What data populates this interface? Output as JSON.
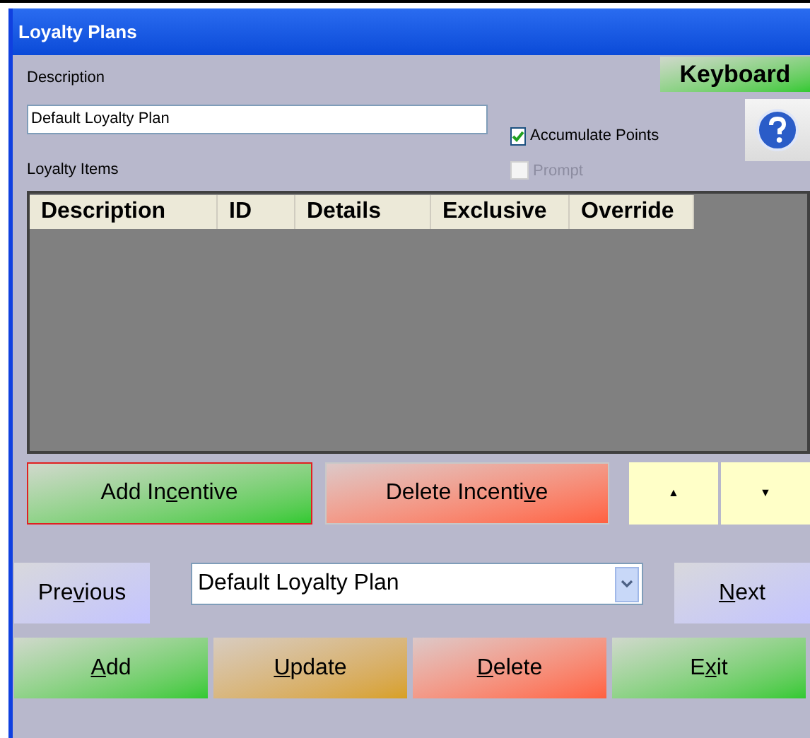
{
  "window": {
    "title": "Loyalty Plans"
  },
  "description": {
    "label": "Description",
    "value": "Default Loyalty Plan"
  },
  "keyboard_button": {
    "label": "Keyboard"
  },
  "options": [
    {
      "label": "Accumulate Points",
      "checked": true,
      "disabled": false
    },
    {
      "label": "Prompt",
      "checked": false,
      "disabled": true
    }
  ],
  "loyalty_items": {
    "label": "Loyalty Items",
    "columns": [
      "Description",
      "ID",
      "Details",
      "Exclusive",
      "Override"
    ]
  },
  "item_buttons": [
    {
      "label": {
        "before": "Add In",
        "key": "c",
        "after": "entive"
      },
      "kind": "green",
      "focused": true
    },
    {
      "label": {
        "before": "Delete Incenti",
        "key": "v",
        "after": "e"
      },
      "kind": "red",
      "focused": false
    }
  ],
  "move_buttons": [
    {
      "label": "▲"
    },
    {
      "label": "▼"
    }
  ],
  "navigation": {
    "previous": {
      "before": "Pre",
      "key": "v",
      "after": "ious"
    },
    "plan": "Default Loyalty Plan",
    "next": {
      "key": "N",
      "after": "ext"
    }
  },
  "bottom_buttons": [
    {
      "label": {
        "key": "A",
        "after": "dd"
      },
      "kind": "green"
    },
    {
      "label": {
        "key": "U",
        "after": "pdate"
      },
      "kind": "gold"
    },
    {
      "label": {
        "key": "D",
        "after": "elete"
      },
      "kind": "red"
    },
    {
      "label": {
        "before": "E",
        "key": "x",
        "after": "it"
      },
      "kind": "green"
    }
  ]
}
